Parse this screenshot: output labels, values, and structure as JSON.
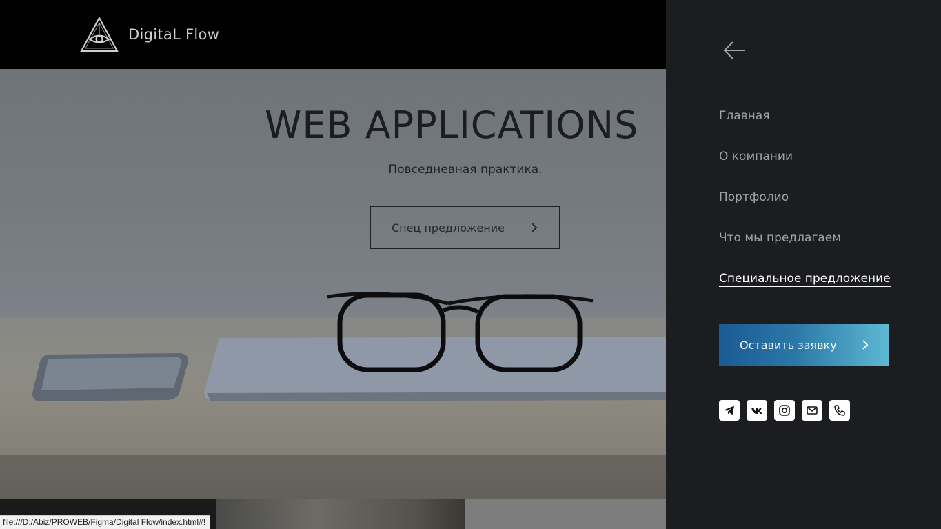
{
  "header": {
    "logo_text": "DigitaL Flow"
  },
  "hero": {
    "title": "WEB APPLICATIONS",
    "subtitle": "Повседневная практика.",
    "button_label": "Спец предложение"
  },
  "side_menu": {
    "back_icon": "arrow-left-icon",
    "nav": [
      {
        "label": "Главная"
      },
      {
        "label": "О компании"
      },
      {
        "label": "Портфолио"
      },
      {
        "label": "Что мы предлагаем"
      },
      {
        "label": "Специальное предложение",
        "active": true
      }
    ],
    "cta_label": "Оставить заявку",
    "cta_gradient": [
      "#1b5a93",
      "#5db9d3"
    ],
    "socials": [
      "telegram-icon",
      "vk-icon",
      "instagram-icon",
      "mail-icon",
      "phone-icon"
    ]
  },
  "status_bar": {
    "url": "file:///D:/Abiz/PROWEB/Figma/Digital Flow/index.html#!"
  },
  "colors": {
    "menu_background": "#1c1d21",
    "menu_text": "#a2a3a7",
    "menu_active": "#ffffff"
  }
}
